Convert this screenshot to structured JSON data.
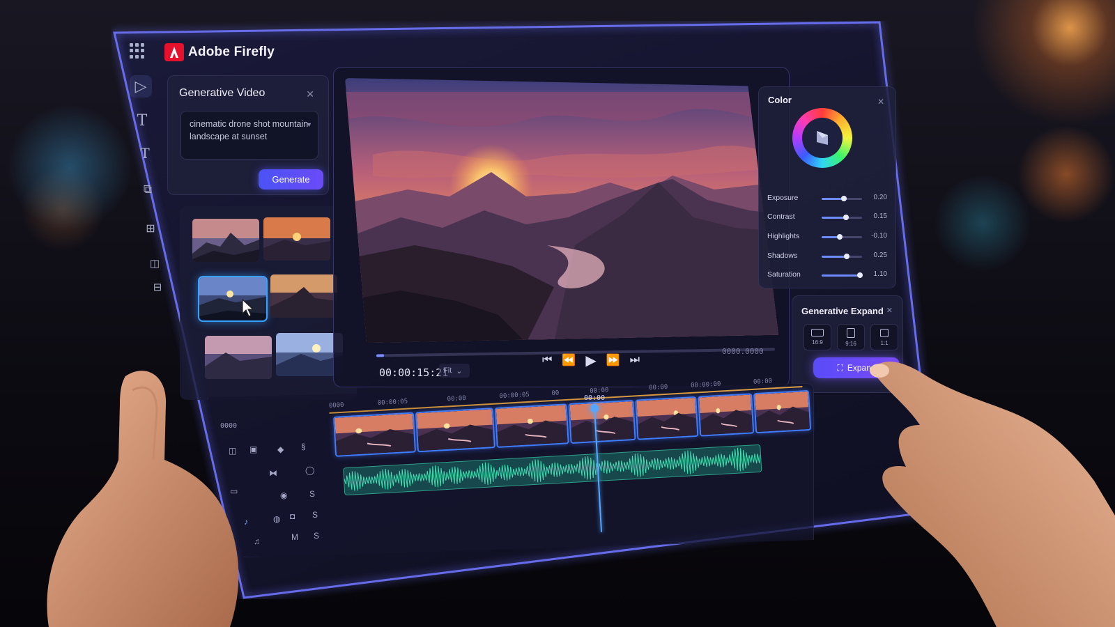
{
  "header": {
    "app_title": "Adobe Firefly",
    "apps_icon": "grid-apps-icon",
    "logo_icon": "adobe-logo-icon"
  },
  "rail": {
    "items": [
      {
        "icon": "play-icon"
      },
      {
        "icon": "text-icon"
      },
      {
        "icon": "text-alt-icon"
      },
      {
        "icon": "effects-icon"
      },
      {
        "icon": "layers-icon"
      },
      {
        "icon": "audio-icon"
      },
      {
        "icon": "adjust-icon"
      }
    ]
  },
  "generative_video": {
    "title": "Generative Video",
    "close_icon": "close-icon",
    "prompt": "cinematic drone shot mountain landscape at sunset",
    "generate_label": "Generate",
    "thumbnails": [
      {
        "selected": false
      },
      {
        "selected": false
      },
      {
        "selected": true
      },
      {
        "selected": false
      },
      {
        "selected": false
      },
      {
        "selected": false
      }
    ]
  },
  "preview": {
    "timecode": "00:00:15:21",
    "fit_label": "Fit",
    "end_timecode": "0000.0000",
    "playback_progress": 0.02,
    "transport": [
      "skip-back-icon",
      "step-back-icon",
      "play-icon",
      "step-forward-icon",
      "skip-forward-icon"
    ]
  },
  "color": {
    "title": "Color",
    "close_icon": "close-icon",
    "sliders": [
      {
        "label": "Exposure",
        "value": "0.20",
        "level": 0.55
      },
      {
        "label": "Contrast",
        "value": "0.15",
        "level": 0.6
      },
      {
        "label": "Highlights",
        "value": "-0.10",
        "level": 0.45
      },
      {
        "label": "Shadows",
        "value": "0.25",
        "level": 0.62
      },
      {
        "label": "Saturation",
        "value": "1.10",
        "level": 0.95
      }
    ]
  },
  "generative_expand": {
    "title": "Generative Expand",
    "ratios": [
      "16:9",
      "9:16",
      "1:1"
    ],
    "expand_label": "Expand"
  },
  "timeline": {
    "start_label": "0000",
    "playhead_label": "00:00",
    "ruler_labels": [
      "0000",
      "00:00:05",
      "00:00",
      "00:00:05",
      "00",
      "00:00",
      "00:00",
      "00:00:00",
      "00:00"
    ]
  },
  "colors": {
    "accent": "#5b4ff7",
    "selection": "#3aa0ff",
    "audio": "#1fb894"
  }
}
